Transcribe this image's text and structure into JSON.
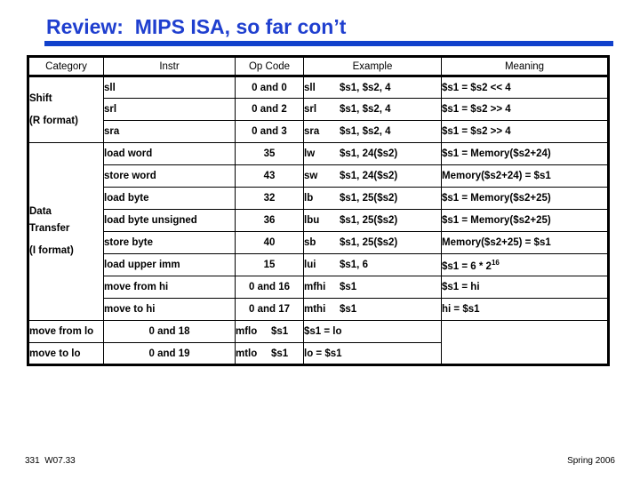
{
  "slide": {
    "title": "Review:  MIPS ISA, so far con’t",
    "accent_color": "#1141CC",
    "title_color": "#1F3FCF",
    "teal_color": "#0E7A70"
  },
  "table": {
    "headers": [
      "Category",
      "Instr",
      "Op Code",
      "Example",
      "Meaning"
    ],
    "categories": [
      {
        "name": "Shift",
        "format": "(R format)",
        "rowspan": 3
      },
      {
        "name": "Data",
        "name2": "Transfer",
        "format": "(I format)",
        "rowspan": 8
      }
    ],
    "rows": [
      {
        "instr": "sll",
        "opcode": "0 and 0",
        "ex_mn": "sll",
        "ex_args": "$s1, $s2, 4",
        "meaning": "$s1 = $s2 << 4",
        "teal": true
      },
      {
        "instr": "srl",
        "opcode": "0 and 2",
        "ex_mn": "srl",
        "ex_args": "$s1, $s2, 4",
        "meaning": "$s1 = $s2 >> 4",
        "teal": true
      },
      {
        "instr": "sra",
        "opcode": "0 and 3",
        "ex_mn": "sra",
        "ex_args": "$s1, $s2, 4",
        "meaning": "$s1 = $s2 >> 4",
        "teal": true
      },
      {
        "instr": "load word",
        "opcode": "35",
        "ex_mn": "lw",
        "ex_args": "$s1, 24($s2)",
        "meaning": "$s1 = Memory($s2+24)",
        "teal": false
      },
      {
        "instr": "store word",
        "opcode": "43",
        "ex_mn": "sw",
        "ex_args": "$s1, 24($s2)",
        "meaning": "Memory($s2+24) = $s1",
        "teal": false
      },
      {
        "instr": "load byte",
        "opcode": "32",
        "ex_mn": "lb",
        "ex_args": "$s1, 25($s2)",
        "meaning": "$s1 = Memory($s2+25)",
        "teal": false
      },
      {
        "instr": "load byte unsigned",
        "opcode": "36",
        "ex_mn": "lbu",
        "ex_args": "$s1, 25($s2)",
        "meaning": "$s1 = Memory($s2+25)",
        "teal": false
      },
      {
        "instr": "store byte",
        "opcode": "40",
        "ex_mn": "sb",
        "ex_args": "$s1, 25($s2)",
        "meaning": "Memory($s2+25) = $s1",
        "teal": false
      },
      {
        "instr": "load upper imm",
        "opcode": "15",
        "ex_mn": "lui",
        "ex_args": "$s1, 6",
        "meaning": "$s1 = 6 * 2",
        "meaning_sup": "16",
        "teal": false
      },
      {
        "instr": "move from hi",
        "opcode": "0 and 16",
        "ex_mn": "mfhi",
        "ex_args": "$s1",
        "meaning": "$s1 = hi",
        "teal": true
      },
      {
        "instr": "move to hi",
        "opcode": "0 and 17",
        "ex_mn": "mthi",
        "ex_args": "$s1",
        "meaning": "hi = $s1",
        "teal": true
      },
      {
        "instr": "move from lo",
        "opcode": "0 and 18",
        "ex_mn": "mflo",
        "ex_args": "$s1",
        "meaning": "$s1 = lo",
        "teal": true
      },
      {
        "instr": "move to lo",
        "opcode": "0 and 19",
        "ex_mn": "mtlo",
        "ex_args": "$s1",
        "meaning": "lo = $s1",
        "teal": true
      }
    ]
  },
  "footer": {
    "left": "331  W07.33",
    "right": "Spring 2006"
  }
}
